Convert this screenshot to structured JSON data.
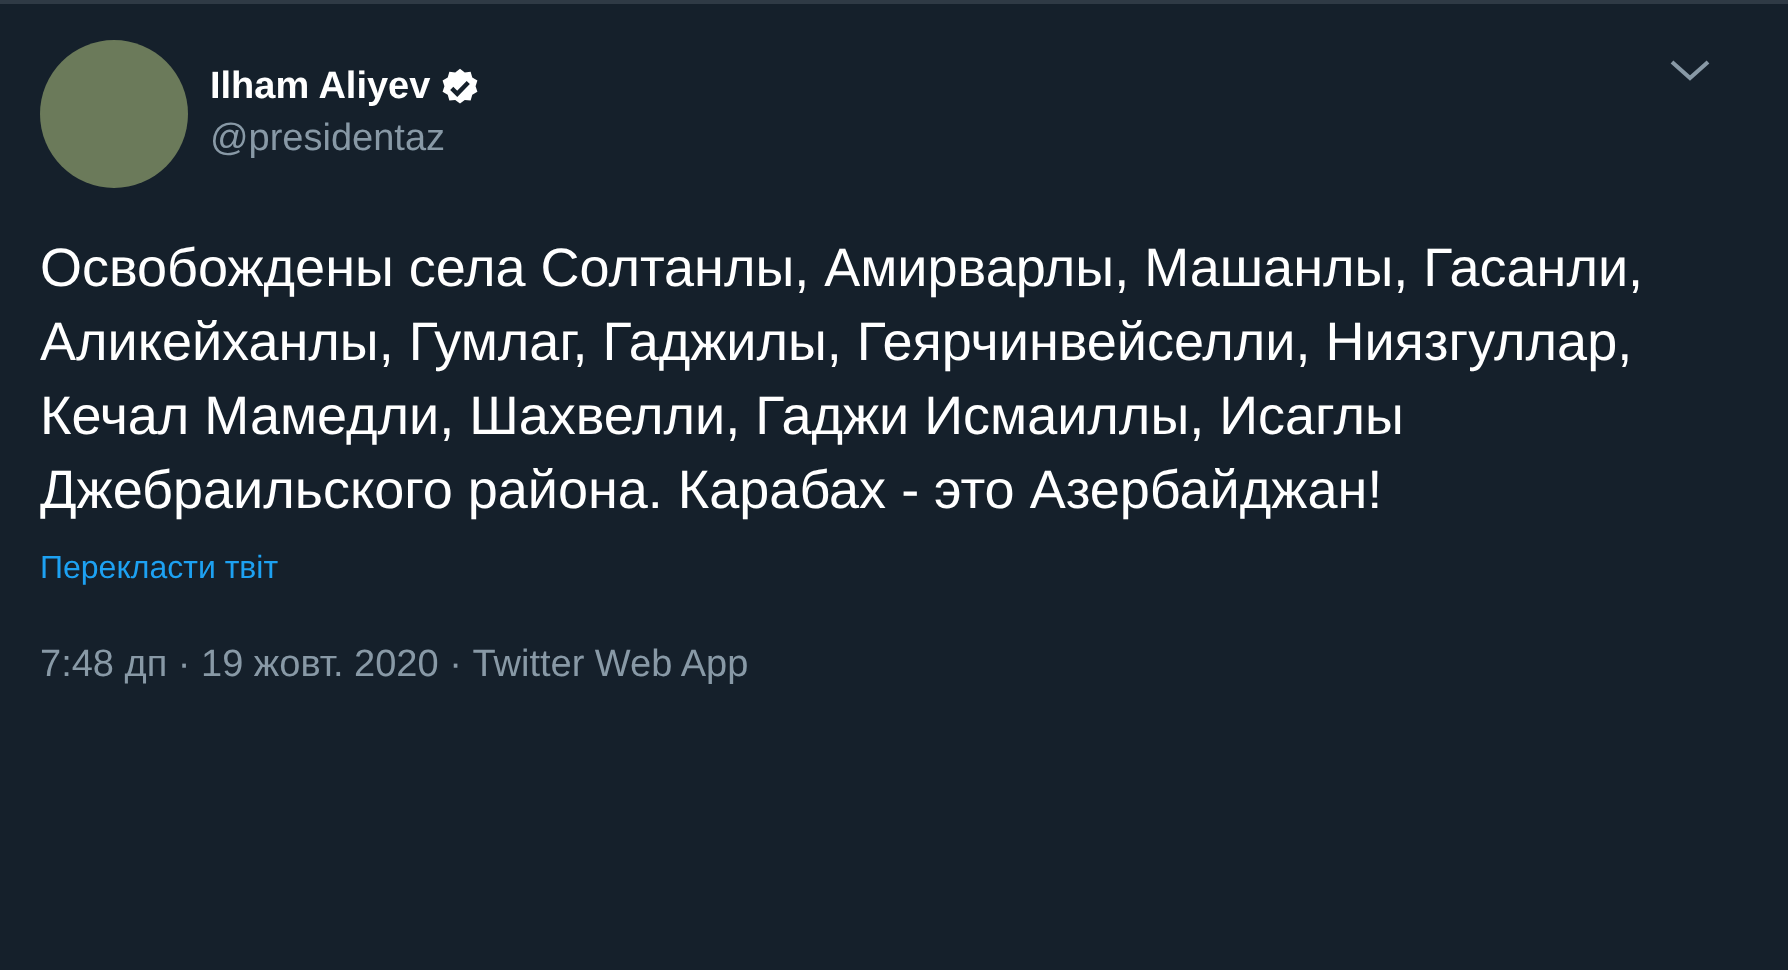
{
  "author": {
    "name": "Ilham Aliyev",
    "verified": true,
    "handle": "@presidentaz"
  },
  "tweet": {
    "text": "Освобождены села Солтанлы, Амирварлы, Машанлы, Гасанли, Аликейханлы, Гумлаг, Гаджилы, Геярчинвейселли, Ниязгуллар, Кечал Мамедли, Шахвелли, Гаджи Исмаиллы, Исаглы Джебраильского района. Карабах - это Азербайджан!",
    "translate_link": "Перекласти твіт",
    "meta": "7:48 дп · 19 жовт. 2020 · Twitter Web App"
  }
}
